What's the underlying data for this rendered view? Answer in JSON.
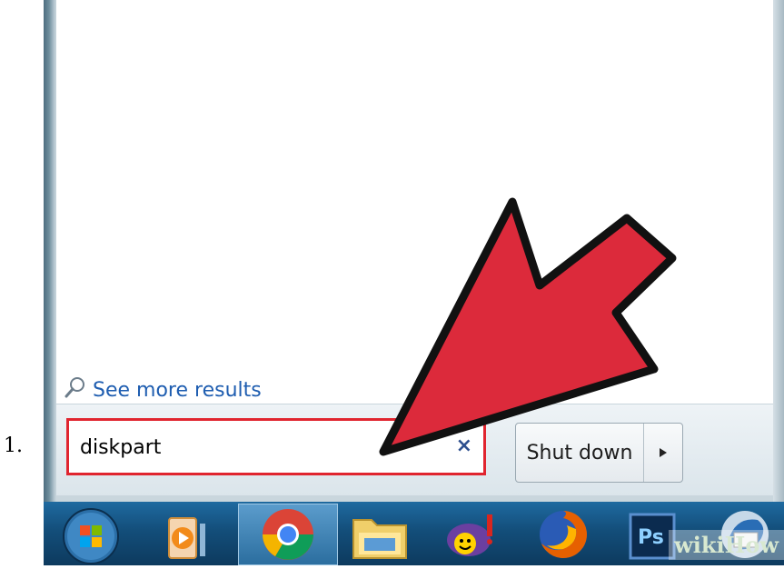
{
  "list_number": "1.",
  "start_menu": {
    "see_more_results": "See more results",
    "search": {
      "value": "diskpart",
      "clear_icon": "close-icon",
      "clear_symbol": "×"
    },
    "shutdown": {
      "label": "Shut down",
      "options_icon": "triangle-right-icon"
    }
  },
  "taskbar": {
    "items": [
      {
        "name": "start-orb",
        "icon": "windows-logo-icon"
      },
      {
        "name": "media-player",
        "icon": "media-player-icon"
      },
      {
        "name": "chrome",
        "icon": "chrome-icon",
        "active": true
      },
      {
        "name": "file-explorer",
        "icon": "folder-icon"
      },
      {
        "name": "yahoo-messenger",
        "icon": "yahoo-messenger-icon"
      },
      {
        "name": "firefox",
        "icon": "firefox-icon"
      },
      {
        "name": "photoshop",
        "icon": "photoshop-icon",
        "label": "Ps"
      },
      {
        "name": "thunderbird",
        "icon": "thunderbird-icon"
      }
    ]
  },
  "watermark": "wikiHow",
  "colors": {
    "highlight": "#e0252f",
    "link": "#1e5db0",
    "taskbar": "#134e7a"
  }
}
